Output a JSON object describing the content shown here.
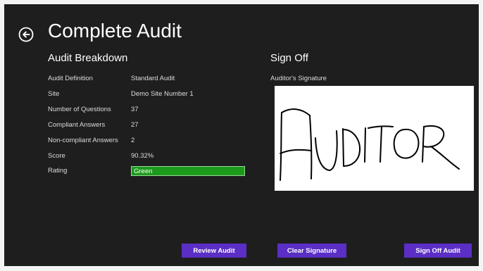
{
  "header": {
    "title": "Complete Audit",
    "back_icon": "back-arrow-circle-icon"
  },
  "breakdown": {
    "title": "Audit Breakdown",
    "rows": [
      {
        "label": "Audit Definition",
        "value": "Standard Audit"
      },
      {
        "label": "Site",
        "value": "Demo Site Number 1"
      },
      {
        "label": "Number of Questions",
        "value": "37"
      },
      {
        "label": "Compliant Answers",
        "value": "27"
      },
      {
        "label": "Non-compliant Answers",
        "value": "2"
      },
      {
        "label": "Score",
        "value": "90.32%"
      },
      {
        "label": "Rating",
        "value": "Green"
      }
    ],
    "rating_color": "#1c9a1c"
  },
  "signoff": {
    "title": "Sign Off",
    "signature_label": "Auditor's Signature",
    "signature_text": "AUDITOR"
  },
  "buttons": {
    "review": "Review Audit",
    "clear": "Clear Signature",
    "signoff": "Sign Off Audit"
  },
  "colors": {
    "background": "#1e1e1e",
    "accent": "#5b2ec5"
  }
}
